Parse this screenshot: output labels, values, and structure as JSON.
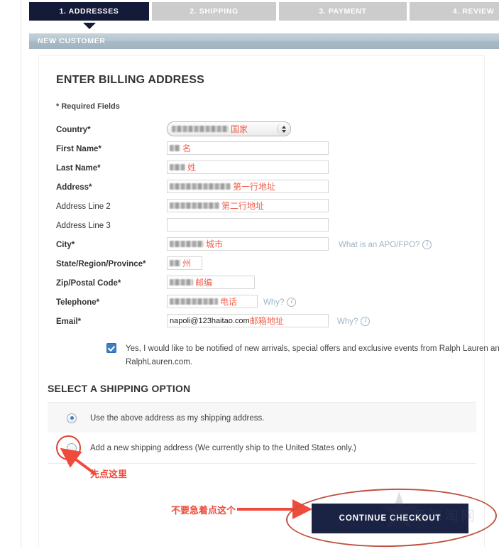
{
  "steps": [
    {
      "label": "1. ADDRESSES",
      "active": true
    },
    {
      "label": "2. SHIPPING",
      "active": false
    },
    {
      "label": "3. PAYMENT",
      "active": false
    },
    {
      "label": "4. REVIEW",
      "active": false
    }
  ],
  "band": {
    "title": "NEW CUSTOMER"
  },
  "form": {
    "heading": "ENTER BILLING ADDRESS",
    "required_note": "* Required Fields",
    "fields": [
      {
        "label": "Country*",
        "bold": true,
        "annotation": "国家",
        "value": "",
        "type": "select"
      },
      {
        "label": "First Name*",
        "bold": true,
        "annotation": "名",
        "value": "",
        "type": "text"
      },
      {
        "label": "Last Name*",
        "bold": true,
        "annotation": "姓",
        "value": "",
        "type": "text"
      },
      {
        "label": "Address*",
        "bold": true,
        "annotation": "第一行地址",
        "value": "",
        "type": "text"
      },
      {
        "label": "Address Line 2",
        "bold": false,
        "annotation": "第二行地址",
        "value": "",
        "type": "text"
      },
      {
        "label": "Address Line 3",
        "bold": false,
        "annotation": "",
        "value": "",
        "type": "text"
      },
      {
        "label": "City*",
        "bold": true,
        "annotation": "城市",
        "value": "",
        "type": "text"
      },
      {
        "label": "State/Region/Province*",
        "bold": true,
        "annotation": "州",
        "value": "",
        "type": "text"
      },
      {
        "label": "Zip/Postal Code*",
        "bold": true,
        "annotation": "邮编",
        "value": "",
        "type": "text"
      },
      {
        "label": "Telephone*",
        "bold": true,
        "annotation": "电话",
        "value": "",
        "type": "text"
      },
      {
        "label": "Email*",
        "bold": true,
        "annotation": "邮箱地址",
        "value": "napoli@123haitao.com",
        "type": "text"
      }
    ],
    "side_links": {
      "apo": "What is an APO/FPO?",
      "why_phone": "Why?",
      "why_email": "Why?"
    }
  },
  "optin": {
    "text": "Yes, I would like to be notified of new arrivals, special offers and exclusive events from Ralph Lauren and RalphLauren.com.",
    "checked": true
  },
  "shipping": {
    "heading": "SELECT A SHIPPING OPTION",
    "options": [
      {
        "label": "Use the above address as my shipping address.",
        "selected": true
      },
      {
        "label": "Add a new shipping address (We currently ship to the United States only.)",
        "selected": false
      }
    ]
  },
  "actions": {
    "continue_label": "CONTINUE CHECKOUT"
  },
  "annotations": {
    "click_here": "先点这里",
    "dont_click": "不要急着点这个"
  },
  "watermark": {
    "text": "秦海淘网",
    "star": "★"
  },
  "colors": {
    "active_step": "#141b38",
    "inactive_step": "#cccccc",
    "band": "#a8bac6",
    "annotation_red": "#ef4b3c",
    "button": "#1b2344",
    "link": "#9fb4c4",
    "control_blue": "#3b7fc4"
  }
}
